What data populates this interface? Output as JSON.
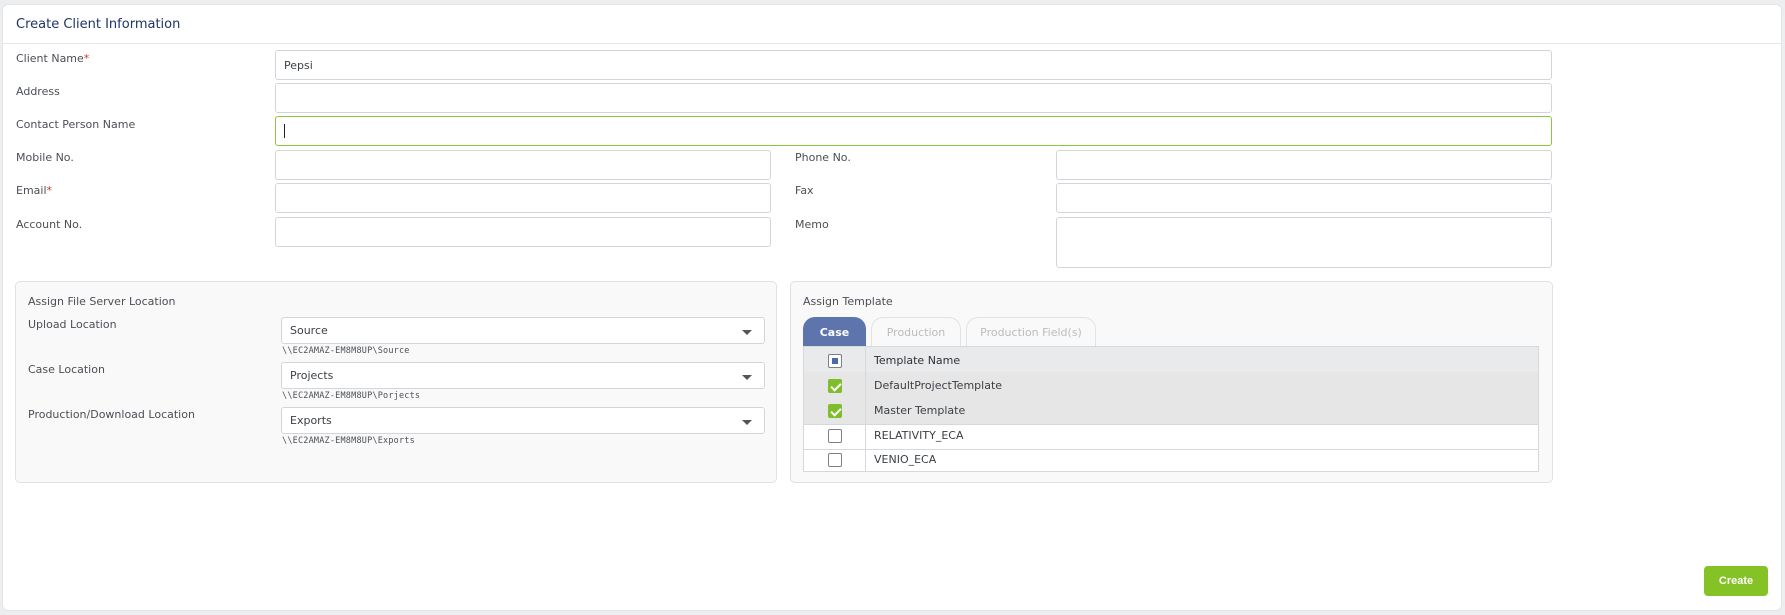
{
  "header": {
    "title": "Create Client Information"
  },
  "form": {
    "client_name": {
      "label": "Client Name",
      "required_mark": "*",
      "value": "Pepsi"
    },
    "address": {
      "label": "Address",
      "value": ""
    },
    "contact_person": {
      "label": "Contact Person Name",
      "value": ""
    },
    "mobile": {
      "label": "Mobile No.",
      "value": ""
    },
    "phone": {
      "label": "Phone No.",
      "value": ""
    },
    "email": {
      "label": "Email",
      "required_mark": "*",
      "value": ""
    },
    "fax": {
      "label": "Fax",
      "value": ""
    },
    "account": {
      "label": "Account No.",
      "value": ""
    },
    "memo": {
      "label": "Memo",
      "value": ""
    }
  },
  "file_server": {
    "title": "Assign File Server Location",
    "upload": {
      "label": "Upload Location",
      "selected": "Source",
      "path": "\\\\EC2AMAZ-EM8M8UP\\Source"
    },
    "case": {
      "label": "Case Location",
      "selected": "Projects",
      "path": "\\\\EC2AMAZ-EM8M8UP\\Porjects"
    },
    "production": {
      "label": "Production/Download Location",
      "selected": "Exports",
      "path": "\\\\EC2AMAZ-EM8M8UP\\Exports"
    }
  },
  "template": {
    "title": "Assign Template",
    "tabs": [
      {
        "label": "Case",
        "active": true
      },
      {
        "label": "Production",
        "active": false
      },
      {
        "label": "Production Field(s)",
        "active": false
      }
    ],
    "column_header": "Template Name",
    "rows": [
      {
        "name": "DefaultProjectTemplate",
        "checked": true
      },
      {
        "name": "Master Template",
        "checked": true
      },
      {
        "name": "RELATIVITY_ECA",
        "checked": false
      },
      {
        "name": "VENIO_ECA",
        "checked": false
      }
    ]
  },
  "actions": {
    "create_label": "Create"
  },
  "colors": {
    "accent_green": "#84c225",
    "tab_active": "#5d75ac",
    "title_blue": "#1d3466",
    "required_red": "#d0342c"
  }
}
